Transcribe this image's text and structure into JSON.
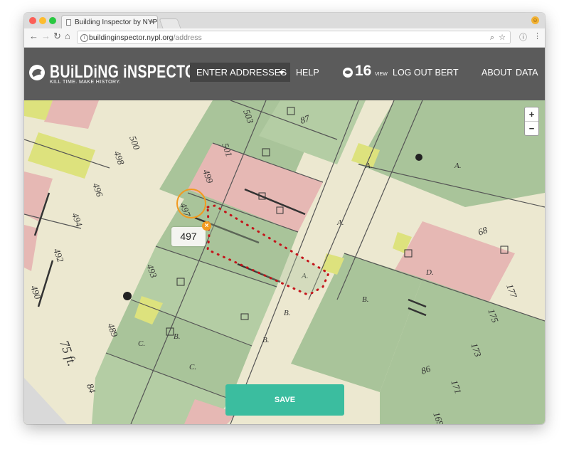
{
  "browser": {
    "tab_title": "Building Inspector by NYPL La",
    "tab_close": "×",
    "url_host": "buildinginspector.nypl.org",
    "url_path": "/address",
    "back": "←",
    "forward": "→",
    "reload": "↻",
    "home": "⌂",
    "info": "i",
    "zoom_icon": "⌕",
    "star_icon": "☆",
    "ext_icon": "ⓘ",
    "menu_icon": "⋮"
  },
  "header": {
    "logo_title": "BUiLDiNG iNSPECTOR",
    "tagline": "KILL TIME. MAKE HISTORY.",
    "dropdown_label": "ENTER ADDRESSES",
    "help": "HELP",
    "view_count": "16",
    "view_label": "VIEW",
    "logout": "LOG OUT BERT",
    "about": "ABOUT",
    "data": "DATA"
  },
  "map": {
    "zoom_in": "+",
    "zoom_out": "−",
    "popup_number": "497",
    "popup_close": "×",
    "labels": {
      "l500": "500",
      "l503": "503",
      "l501": "501",
      "l498": "498",
      "l496": "496",
      "l499": "499",
      "l497": "497",
      "l494": "494",
      "l492": "492",
      "l490": "490",
      "l493": "493",
      "l489": "489",
      "l75ft": "75 ft.",
      "l84": "84",
      "l87": "87",
      "l177": "177",
      "l175": "175",
      "l173": "173",
      "l171": "171",
      "l169": "169",
      "l68": "68",
      "l86": "86",
      "lA1": "A.",
      "lA2": "A.",
      "lA3": "A.",
      "lA4": "A.",
      "lB1": "B.",
      "lB2": "B.",
      "lB3": "B.",
      "lC1": "C.",
      "lC2": "C.",
      "lD1": "D.",
      "lB4": "B."
    }
  },
  "save_label": "SAVE",
  "colors": {
    "header_bg": "#5b5b5b",
    "save_green": "#3bbd9f",
    "parcel_green": "#a9c49a",
    "parcel_pink": "#e6b8b4",
    "footprint_dots": "#c4141a",
    "marker_orange": "#f29a1f"
  }
}
